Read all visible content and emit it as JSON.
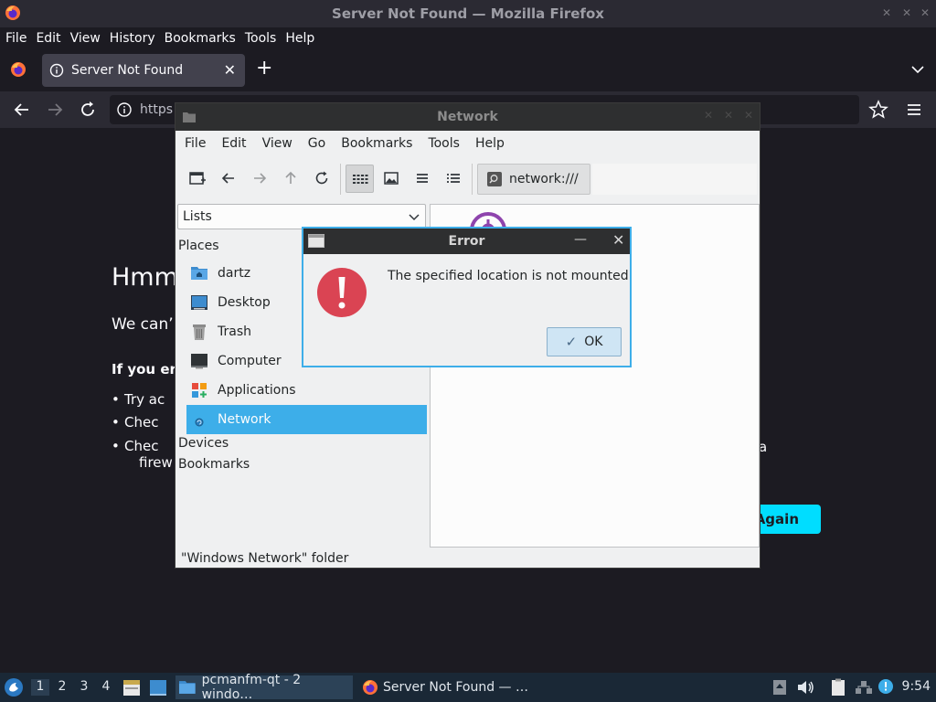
{
  "firefox": {
    "window_title": "Server Not Found — Mozilla Firefox",
    "menu": [
      "File",
      "Edit",
      "View",
      "History",
      "Bookmarks",
      "Tools",
      "Help"
    ],
    "tab_label": "Server Not Found",
    "url_text": "https",
    "page": {
      "title": "Hmm",
      "desc": "We can’",
      "sub": "If you er",
      "bullets": [
        "Try ac",
        "Chec",
        "Chec"
      ],
      "bullet3_cont": "firew",
      "tail": "a",
      "try_again": "Again"
    }
  },
  "filemanager": {
    "window_title": "Network",
    "menu": [
      "File",
      "Edit",
      "View",
      "Go",
      "Bookmarks",
      "Tools",
      "Help"
    ],
    "location": "network:///",
    "side_combo": "Lists",
    "sections": [
      "Places",
      "Devices",
      "Bookmarks"
    ],
    "places": [
      {
        "label": "dartz",
        "icon": "home-folder-icon"
      },
      {
        "label": "Desktop",
        "icon": "desktop-icon"
      },
      {
        "label": "Trash",
        "icon": "trash-icon"
      },
      {
        "label": "Computer",
        "icon": "computer-icon"
      },
      {
        "label": "Applications",
        "icon": "applications-icon"
      },
      {
        "label": "Network",
        "icon": "network-icon",
        "selected": true
      }
    ],
    "status": "\"Windows Network\" folder"
  },
  "dialog": {
    "title": "Error",
    "message": "The specified location is not mounted",
    "ok_label": "OK"
  },
  "taskbar": {
    "workspaces": [
      "1",
      "2",
      "3",
      "4"
    ],
    "tasks": [
      "pcmanfm-qt - 2 windo…",
      "Server Not Found — …"
    ],
    "clock": "9:54"
  },
  "colors": {
    "accent": "#3daee9",
    "error_red": "#da4453",
    "firefox_dark": "#1c1b22",
    "try_again": "#00ddff"
  }
}
